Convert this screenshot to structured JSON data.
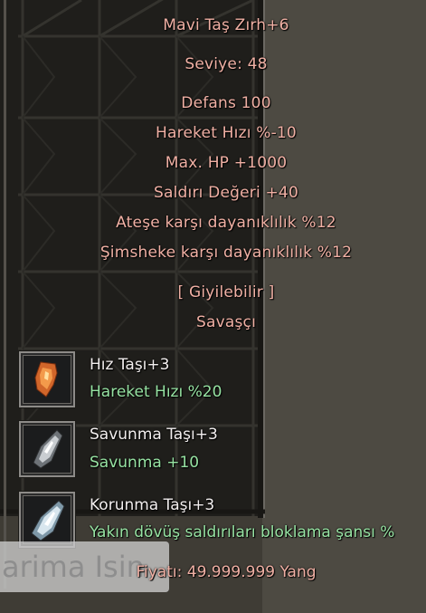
{
  "item": {
    "name": "Mavi Taş Zırh+6",
    "level": "Seviye: 48",
    "stats": [
      "Defans 100",
      "Hareket Hızı %-10",
      "Max. HP +1000",
      "Saldırı Değeri +40",
      "Ateşe karşı dayanıklılık %12",
      "Şimsheke karşı dayanıklılık %12"
    ],
    "wearable": "[ Giyilebilir ]",
    "class": "Savaşçı"
  },
  "stones": [
    {
      "name": "Hız Taşı+3",
      "bonus": "Hareket Hızı %20",
      "icon": "speed-stone-icon"
    },
    {
      "name": "Savunma Taşı+3",
      "bonus": "Savunma +10",
      "icon": "defense-stone-icon"
    },
    {
      "name": "Korunma Taşı+3",
      "bonus": "Yakın dövüş saldırıları bloklama şansı %",
      "icon": "protection-stone-icon"
    }
  ],
  "background_label": "arima Isin",
  "price": "Fiyatı: 49.999.999 Yang",
  "colors": {
    "item_text": "#f0b0a4",
    "stone_name": "#f2eeee",
    "stone_bonus": "#96e2a2"
  }
}
